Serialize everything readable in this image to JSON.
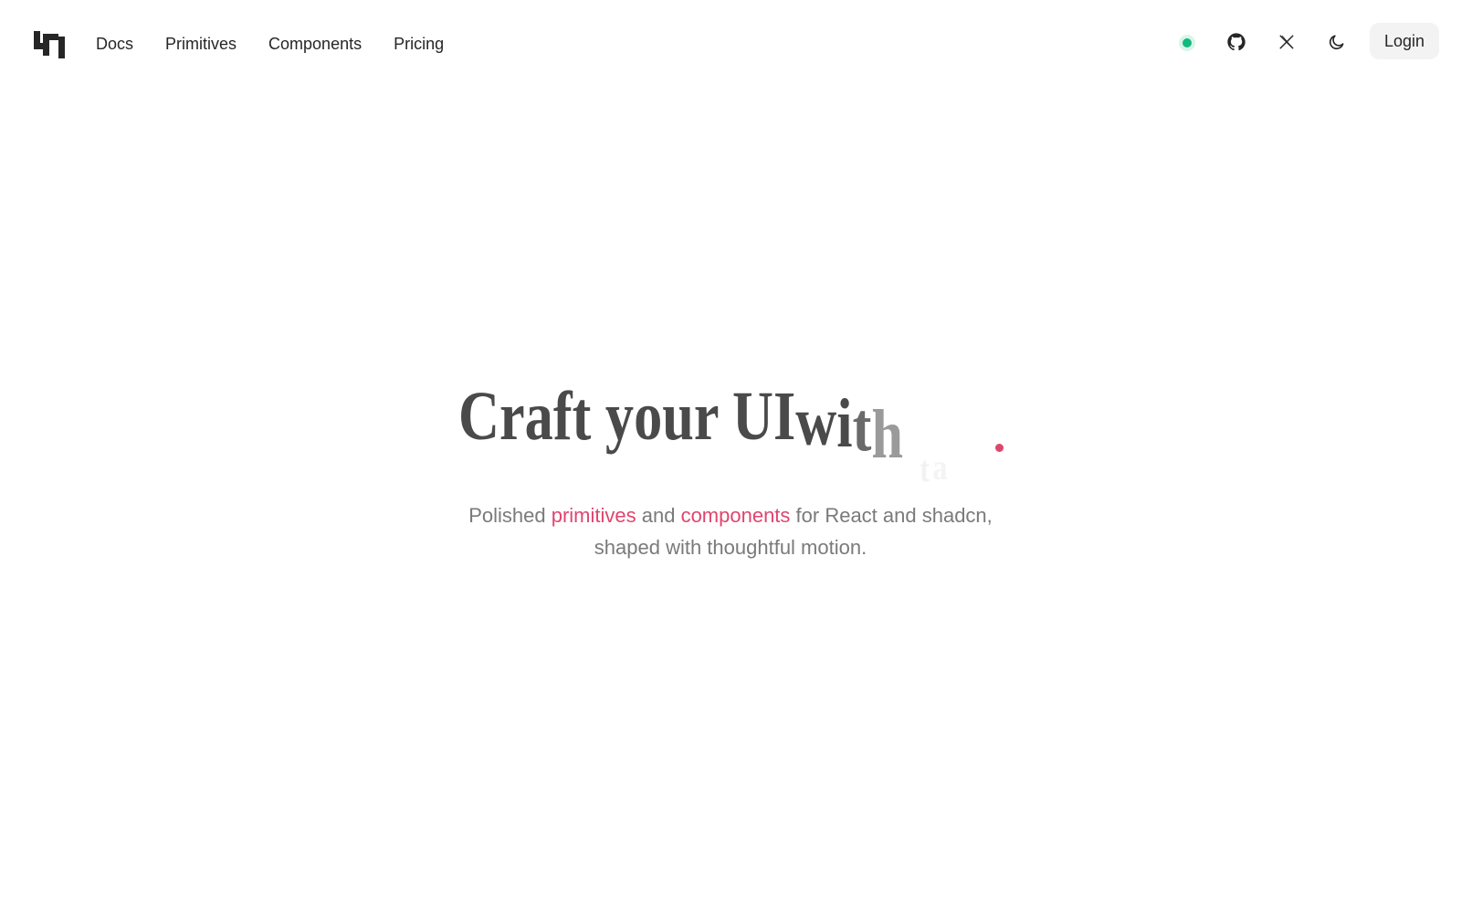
{
  "header": {
    "logo_name": "brand-logo",
    "nav": [
      {
        "label": "Docs"
      },
      {
        "label": "Primitives"
      },
      {
        "label": "Components"
      },
      {
        "label": "Pricing"
      }
    ],
    "status_color": "#10b981",
    "icons": [
      "github-icon",
      "x-icon",
      "moon-icon"
    ],
    "login_label": "Login"
  },
  "hero": {
    "title_main": "Craft your UI ",
    "title_w": "w",
    "title_i": "i",
    "title_t": "t",
    "title_h": "h",
    "title_ghost_1": "t",
    "title_ghost_2": "a",
    "subtitle_1": "Polished ",
    "subtitle_accent_1": "primitives",
    "subtitle_2": " and ",
    "subtitle_accent_2": "components",
    "subtitle_3": " for React and shadcn,",
    "subtitle_4": "shaped with thoughtful motion.",
    "accent_color": "#e0456e"
  }
}
